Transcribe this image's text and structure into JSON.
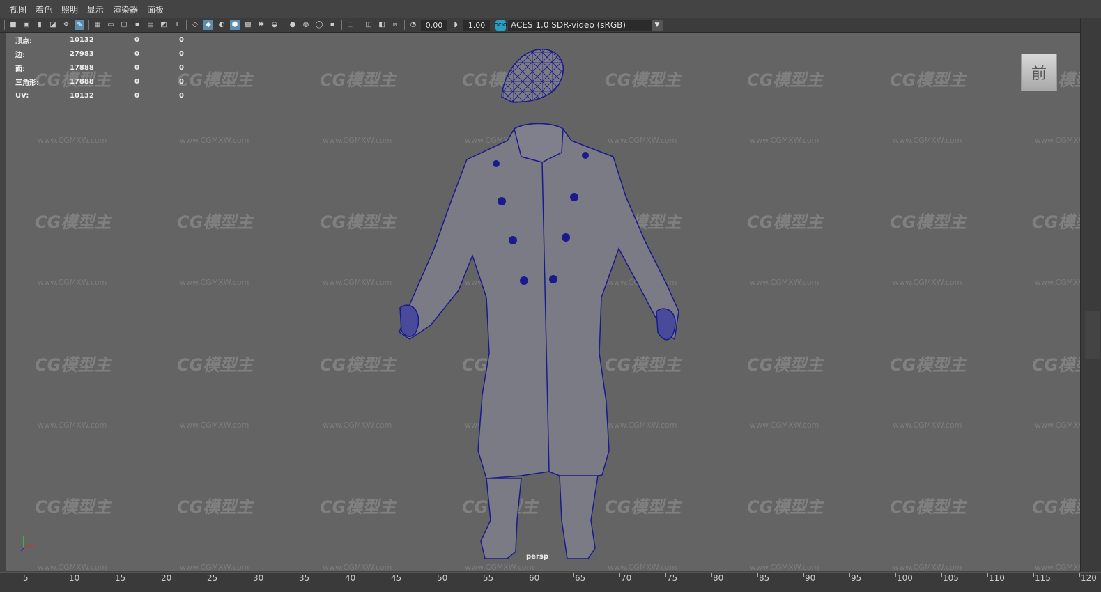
{
  "menu": [
    "视图",
    "着色",
    "照明",
    "显示",
    "渲染器",
    "面板"
  ],
  "toolbar": {
    "exposure": "0.00",
    "gamma": "1.00",
    "colorspace_icon": "OCIO",
    "colorspace": "ACES 1.0 SDR-video (sRGB)",
    "icons": [
      "camera-icon",
      "camera-attr-icon",
      "bookmark-icon",
      "image-plane-icon",
      "grease-pencil-icon",
      "2d-pan-icon",
      "grid-icon",
      "film-gate-icon",
      "resolution-gate-icon",
      "gate-mask-icon",
      "field-chart-icon",
      "safe-action-icon",
      "safe-title-icon",
      "wireframe-icon",
      "smooth-shade-icon",
      "default-material-icon",
      "wireframe-on-shaded-icon",
      "textured-icon",
      "use-lights-icon",
      "shadows-icon",
      "screen-space-ao-icon",
      "motion-blur-icon",
      "anti-alias-icon",
      "depth-of-field-icon",
      "isolate-select-icon",
      "xray-icon",
      "xray-active-icon",
      "xray-joints-icon"
    ]
  },
  "hud": {
    "rows": [
      {
        "label": "顶点:",
        "v1": "10132",
        "v2": "0",
        "v3": "0"
      },
      {
        "label": "边:",
        "v1": "27983",
        "v2": "0",
        "v3": "0"
      },
      {
        "label": "面:",
        "v1": "17888",
        "v2": "0",
        "v3": "0"
      },
      {
        "label": "三角形:",
        "v1": "17888",
        "v2": "0",
        "v3": "0"
      },
      {
        "label": "UV:",
        "v1": "10132",
        "v2": "0",
        "v3": "0"
      }
    ]
  },
  "viewcube": "前",
  "camera": "persp",
  "watermark": {
    "logo": "CG模型主",
    "url": "www.CGMXW.com"
  },
  "timeline": {
    "ticks": [
      "5",
      "10",
      "15",
      "20",
      "25",
      "30",
      "35",
      "40",
      "45",
      "50",
      "55",
      "60",
      "65",
      "70",
      "75",
      "80",
      "85",
      "90",
      "95",
      "100",
      "105",
      "110",
      "115",
      "120"
    ]
  },
  "colors": {
    "wire": "#1a1a8c",
    "fill": "#7b7b86",
    "viewport": "#646464"
  }
}
